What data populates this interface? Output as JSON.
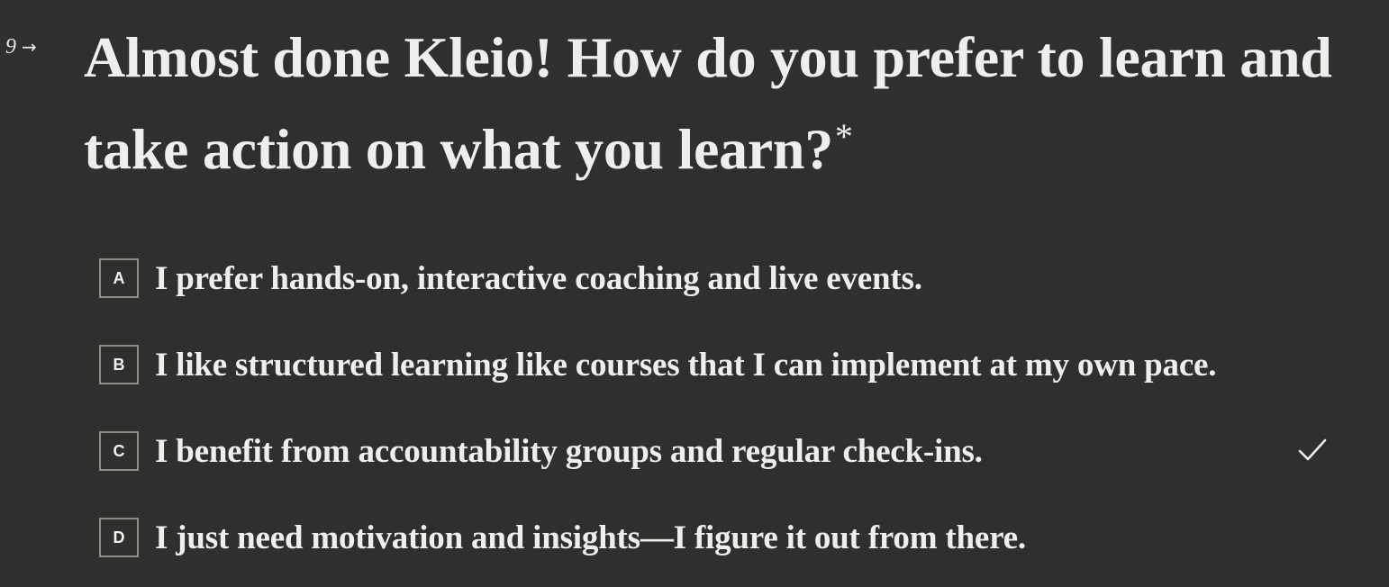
{
  "question": {
    "number": "9",
    "arrow_icon": "arrow-right-icon",
    "title": "Almost done Kleio! How do you prefer to learn and take action on what you learn?",
    "required_mark": "*"
  },
  "options": [
    {
      "key": "A",
      "label": "I prefer hands-on, interactive coaching and live events.",
      "selected": false
    },
    {
      "key": "B",
      "label": "I like structured learning like courses that I can implement at my own pace.",
      "selected": false
    },
    {
      "key": "C",
      "label": "I benefit from accountability groups and regular check-ins.",
      "selected": true
    },
    {
      "key": "D",
      "label": "I just need motivation and insights—I figure it out from there.",
      "selected": false
    }
  ],
  "selected_icon": "checkmark-icon",
  "colors": {
    "background": "#302f2d",
    "text": "#efeeec",
    "key_border": "#8f8e8b"
  }
}
